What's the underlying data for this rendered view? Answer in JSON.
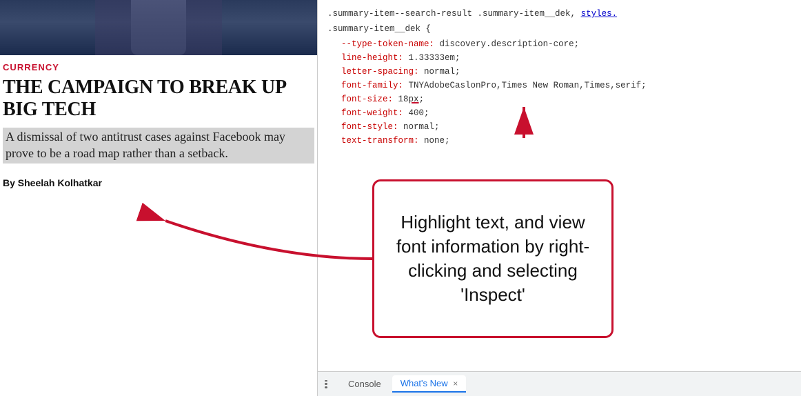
{
  "left_panel": {
    "category": "CURRENCY",
    "title": "THE CAMPAIGN TO BREAK UP BIG TECH",
    "dek": "A dismissal of two antitrust cases against Facebook may prove to be a road map rather than a setback.",
    "byline_label": "By",
    "byline_author": "Sheelah Kolhatkar"
  },
  "devtools": {
    "selectors": ".summary-item--search-result .summary-item__dek,",
    "selector2": ".summary-item__dek {",
    "styles_link": "styles.",
    "props": [
      {
        "name": "--type-token-name:",
        "value": "discovery.description-core;"
      },
      {
        "name": "line-height:",
        "value": "1.33333em;"
      },
      {
        "name": "letter-spacing:",
        "value": "normal;"
      },
      {
        "name": "font-family:",
        "value": "TNYAdobeCaslonPro,Times New Roman,Times,serif;"
      },
      {
        "name": "font-size:",
        "value": "18px;"
      },
      {
        "name": "font-weight:",
        "value": "400;"
      },
      {
        "name": "font-style:",
        "value": "normal;"
      },
      {
        "name": "text-transform:",
        "value": "none;"
      }
    ],
    "closing_brace": "}",
    "tabs": [
      {
        "label": "Console",
        "active": false
      },
      {
        "label": "What's New",
        "active": true
      }
    ]
  },
  "callout": {
    "text": "Highlight text, and view font information by right-clicking and selecting 'Inspect'"
  }
}
